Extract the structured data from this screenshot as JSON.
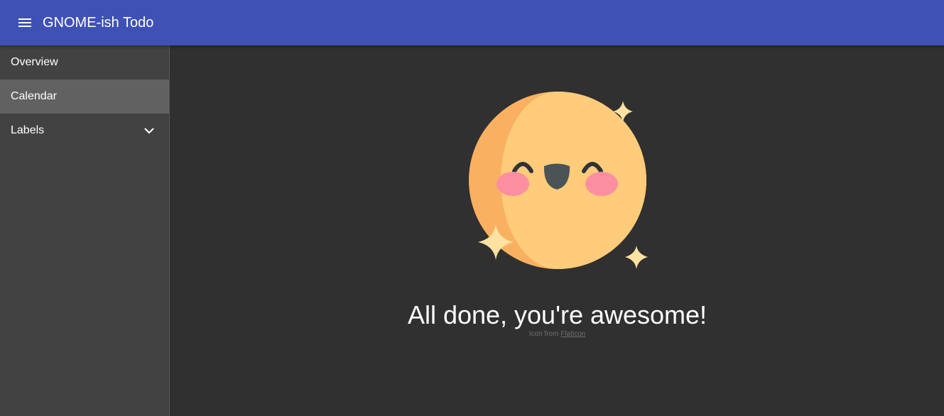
{
  "app": {
    "title": "GNOME-ish Todo",
    "menu_icon": "hamburger-menu-icon",
    "primary_color": "#3f51b5"
  },
  "sidebar": {
    "items": [
      {
        "label": "Overview",
        "active": false
      },
      {
        "label": "Calendar",
        "active": true
      },
      {
        "label": "Labels",
        "active": false,
        "expandable": true,
        "icon": "chevron-down-icon"
      }
    ]
  },
  "main": {
    "illustration": "happy-moon-icon",
    "message": "All done, you're awesome!",
    "credit_prefix": "Icon from ",
    "credit_link": "Flaticon"
  }
}
